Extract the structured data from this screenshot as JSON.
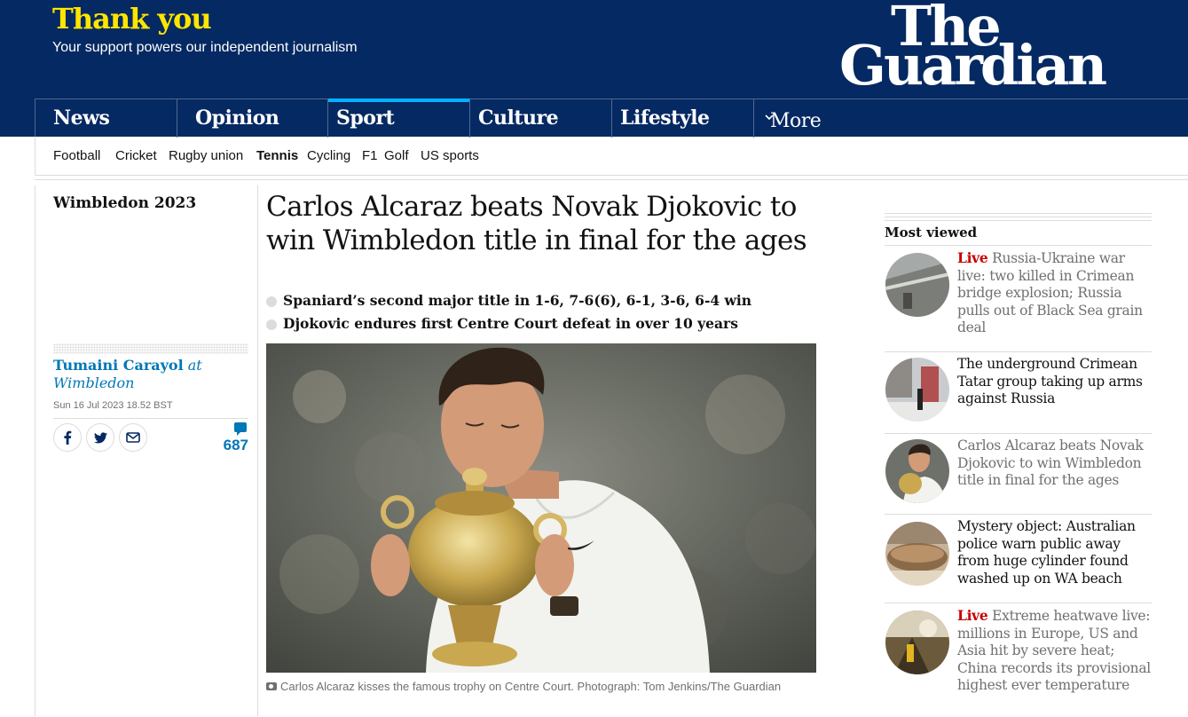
{
  "header": {
    "thanks_title": "Thank you",
    "thanks_subtitle": "Your support powers our independent journalism",
    "logo_line1": "The",
    "logo_line2": "Guardian"
  },
  "pillars": [
    {
      "label": "News"
    },
    {
      "label": "Opinion"
    },
    {
      "label": "Sport",
      "active": true
    },
    {
      "label": "Culture"
    },
    {
      "label": "Lifestyle"
    }
  ],
  "more_label": "More",
  "subnav": [
    "Football",
    "Cricket",
    "Rugby union",
    "Tennis",
    "Cycling",
    "F1",
    "Golf",
    "US sports"
  ],
  "subnav_active": "Tennis",
  "article": {
    "series": "Wimbledon 2023",
    "headline": "Carlos Alcaraz beats Novak Djokovic to win Wimbledon title in final for the ages",
    "standfirst": [
      "Spaniard’s second major title in 1-6, 7-6(6), 6-1, 3-6, 6-4 win",
      "Djokovic endures first Centre Court defeat in over 10 years"
    ],
    "author": "Tumaini Carayol",
    "author_suffix": "at Wimbledon",
    "date": "Sun 16 Jul 2023 18.52 BST",
    "comment_count": "687",
    "caption": "Carlos Alcaraz kisses the famous trophy on Centre Court. Photograph: Tom Jenkins/The Guardian"
  },
  "share_icons": [
    "facebook-icon",
    "twitter-icon",
    "email-icon"
  ],
  "most_viewed": {
    "title": "Most viewed",
    "items": [
      {
        "live": "Live",
        "text": "Russia-Ukraine war live: two killed in Crimean bridge explosion; Russia pulls out of Black Sea grain deal"
      },
      {
        "live": "",
        "text": "The underground Crimean Tatar group taking up arms against Russia"
      },
      {
        "live": "",
        "text": "Carlos Alcaraz beats Novak Djokovic to win Wimbledon title in final for the ages"
      },
      {
        "live": "",
        "text": "Mystery object: Australian police warn public away from huge cylinder found washed up on WA beach"
      },
      {
        "live": "Live",
        "text": "Extreme heatwave live: millions in Europe, US and Asia hit by severe heat; China records its provisional highest ever temperature"
      }
    ]
  },
  "colors": {
    "brand_blue": "#052962",
    "yellow": "#ffe500",
    "sport_accent": "#00b2ff",
    "link_blue": "#0077b6",
    "live_red": "#c70000"
  }
}
